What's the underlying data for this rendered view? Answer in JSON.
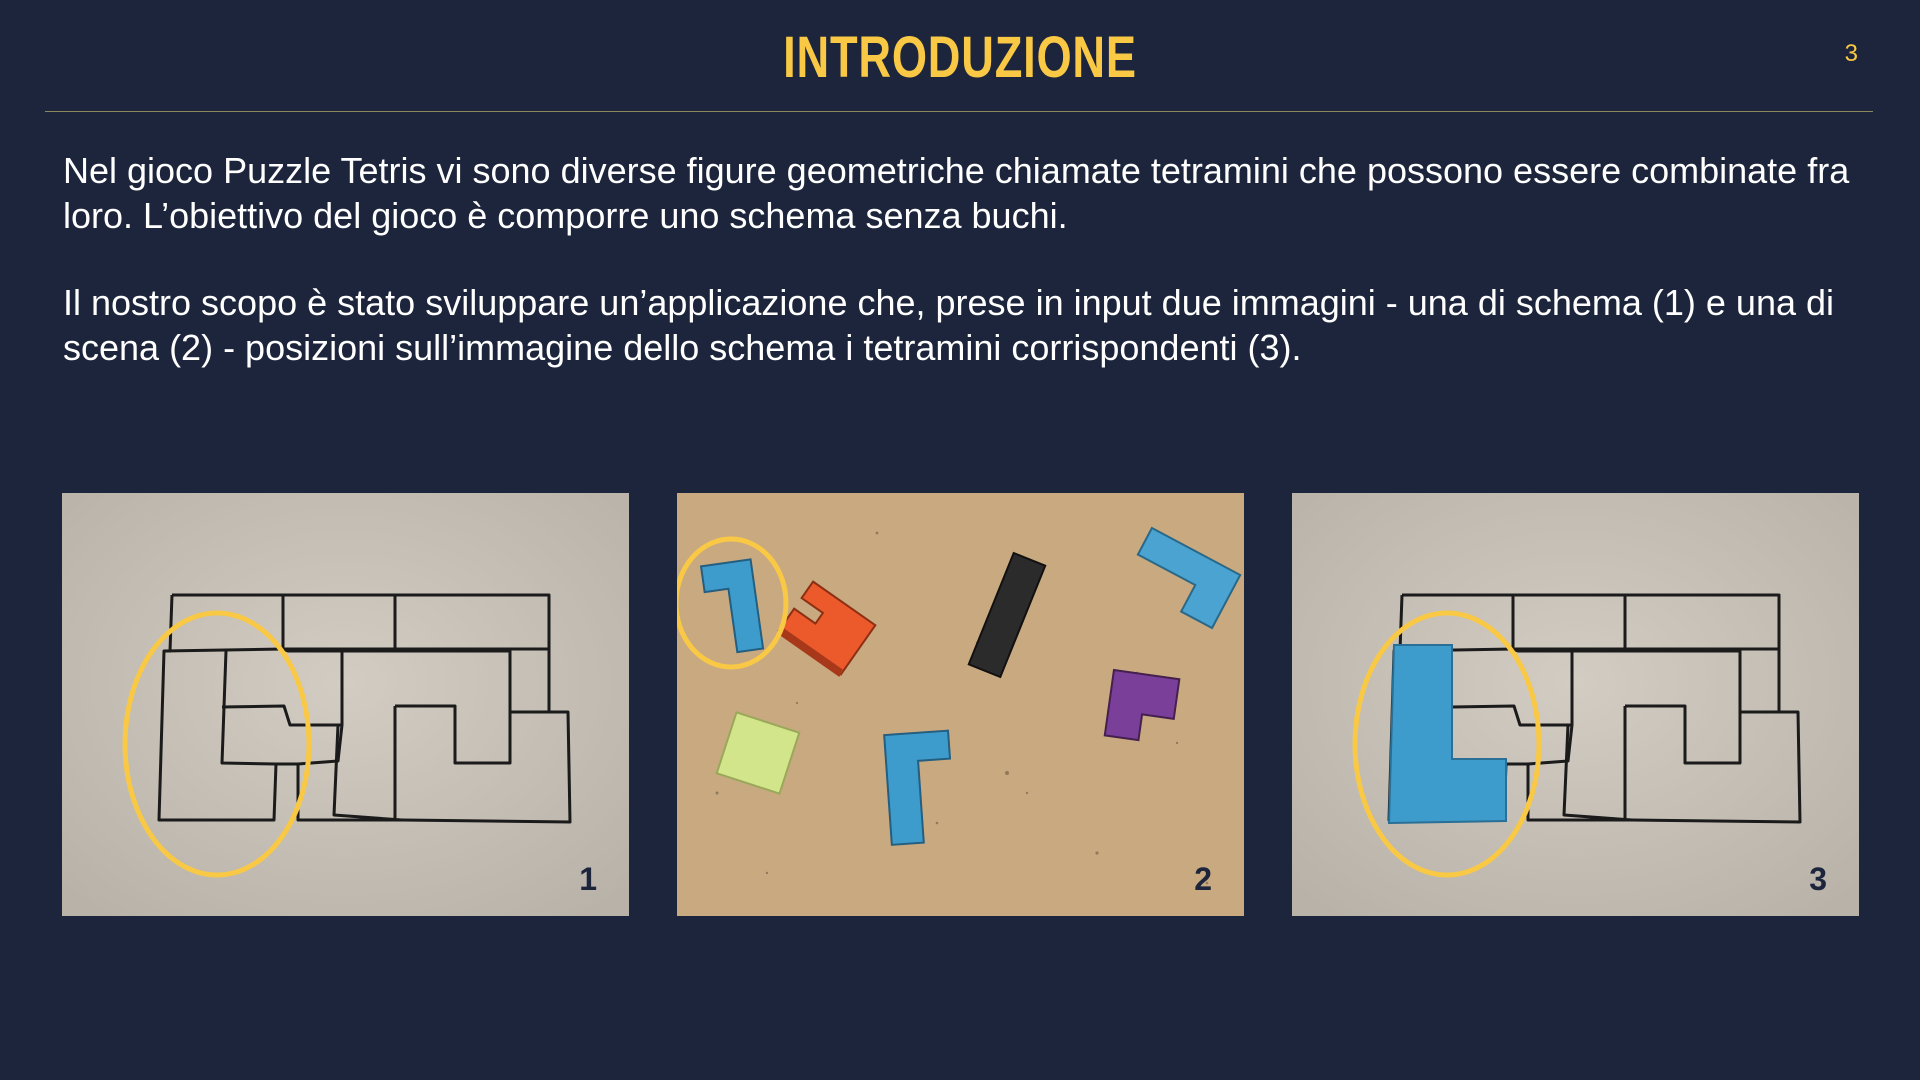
{
  "header": {
    "title": "INTRODUZIONE",
    "page_number": "3"
  },
  "body": {
    "paragraph1": "Nel gioco Puzzle Tetris vi sono diverse figure geometriche chiamate tetramini che possono essere combinate fra loro. L’obiettivo del gioco è comporre uno schema senza buchi.",
    "paragraph2": "Il nostro scopo è stato sviluppare un’applicazione che, prese in input due immagini - una di schema (1) e una di scena (2) - posizioni sull’immagine dello schema i tetramini corrispondenti (3)."
  },
  "figures": [
    {
      "label": "1",
      "icon": "schema-photo"
    },
    {
      "label": "2",
      "icon": "scene-photo"
    },
    {
      "label": "3",
      "icon": "result-photo"
    }
  ],
  "colors": {
    "background": "#1c253b",
    "accent": "#f9c845",
    "paper": "#cbc5bc",
    "board": "#c9a980",
    "blue_piece": "#3e9ccc",
    "orange_piece": "#ec5a2c",
    "black_piece": "#2b2b2b",
    "purple_piece": "#7a3f98",
    "green_piece": "#d3e58a"
  }
}
